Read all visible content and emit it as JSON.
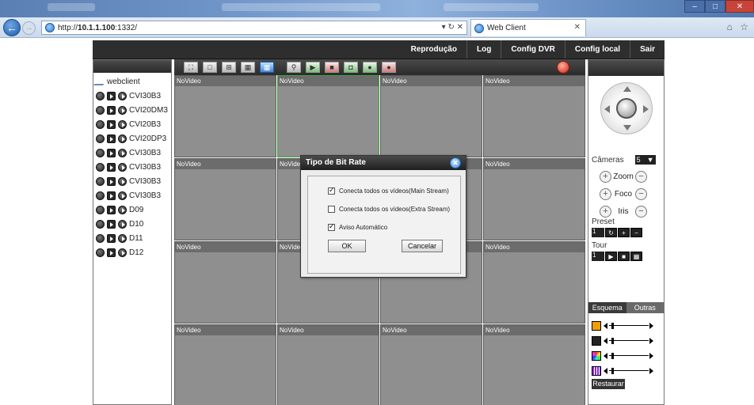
{
  "browser": {
    "url_prefix": "http://",
    "url_host": "10.1.1.100",
    "url_suffix": ":1332/",
    "address_controls": "▾ ↻ ✕",
    "tab_title": "Web Client",
    "tab_close": "✕",
    "right_icons": "⌂ ☆",
    "back_glyph": "←",
    "forward_glyph": "→"
  },
  "menu": {
    "items": [
      "Reprodução",
      "Log",
      "Config DVR",
      "Config local",
      "Sair"
    ]
  },
  "sidebar": {
    "root": "webclient",
    "devices": [
      "CVI30B3",
      "CVI20DM3",
      "CVI20B3",
      "CVI20DP3",
      "CVI30B3",
      "CVI30B3",
      "CVI30B3",
      "CVI30B3",
      "D09",
      "D10",
      "D11",
      "D12"
    ]
  },
  "video": {
    "cell_label": "NoVideo"
  },
  "ptz": {
    "cameras_label": "Câmeras",
    "camera_value": "5",
    "zoom_label": "Zoom",
    "focus_label": "Foco",
    "iris_label": "Iris",
    "preset_label": "Preset",
    "preset_value": "1",
    "tour_label": "Tour",
    "tour_value": "1",
    "tab_scheme": "Esquema",
    "tab_other": "Outras",
    "restore_label": "Restaurar"
  },
  "dialog": {
    "title": "Tipo de Bit Rate",
    "options": [
      {
        "label": "Conecta todos os vídeos(Main Stream)",
        "checked": true
      },
      {
        "label": "Conecta todos os vídeos(Extra Stream)",
        "checked": false
      },
      {
        "label": "Aviso Automático",
        "checked": true
      }
    ],
    "ok_label": "OK",
    "cancel_label": "Cancelar"
  },
  "colors": {
    "menu_bg": "#2e2e2e",
    "video_cell": "#8f8f8f",
    "selected_cell_border": "#3aa83a",
    "toolbar_active": "#3a86d6"
  }
}
